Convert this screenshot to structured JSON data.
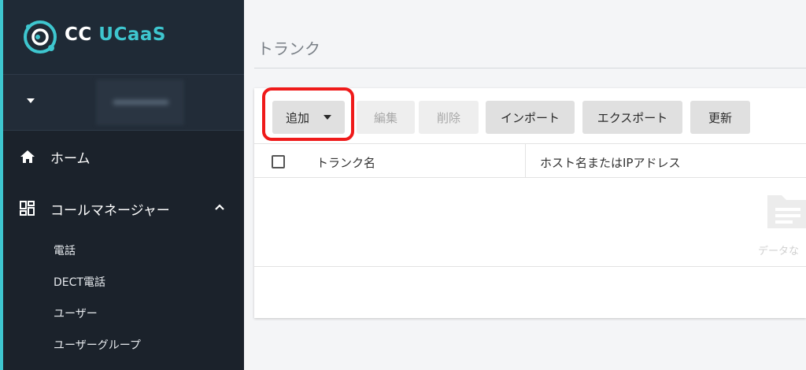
{
  "logo": {
    "prefix": "CC ",
    "accent": "UCaaS"
  },
  "sidebar": {
    "home_label": "ホーム",
    "call_manager_label": "コールマネージャー",
    "sub_items": [
      {
        "label": "電話"
      },
      {
        "label": "DECT電話"
      },
      {
        "label": "ユーザー"
      },
      {
        "label": "ユーザーグループ"
      }
    ]
  },
  "page": {
    "title": "トランク"
  },
  "toolbar": {
    "add_label": "追加",
    "edit_label": "編集",
    "delete_label": "削除",
    "import_label": "インポート",
    "export_label": "エクスポート",
    "refresh_label": "更新"
  },
  "table": {
    "columns": [
      {
        "label": "トランク名"
      },
      {
        "label": "ホスト名またはIPアドレス"
      }
    ],
    "empty_text": "データな"
  },
  "colors": {
    "accent": "#3ec6cf",
    "highlight": "#ef1a1a",
    "sidebar_bg": "#1b222b"
  }
}
